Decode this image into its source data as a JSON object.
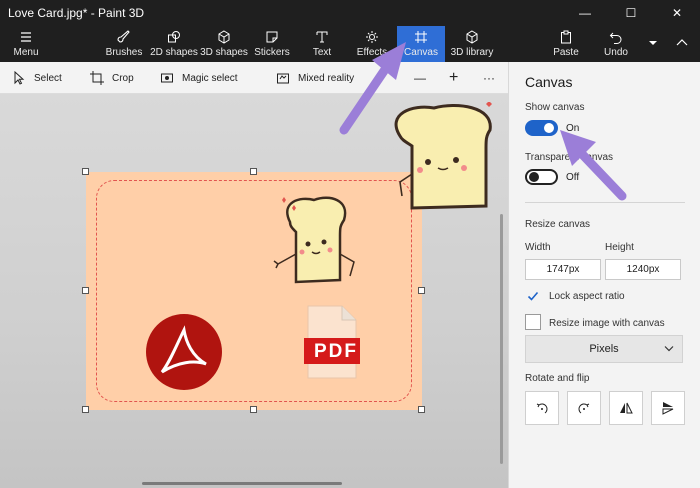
{
  "window": {
    "title": "Love Card.jpg* - Paint 3D",
    "minimize_glyph": "—",
    "maximize_glyph": "☐",
    "close_glyph": "✕"
  },
  "ribbon": {
    "menu": {
      "label": "Menu",
      "icon": "hamburger-menu-icon"
    },
    "tools": [
      {
        "label": "Brushes",
        "icon": "brush-icon"
      },
      {
        "label": "2D shapes",
        "icon": "2d-shapes-icon"
      },
      {
        "label": "3D shapes",
        "icon": "3d-shapes-icon"
      },
      {
        "label": "Stickers",
        "icon": "sticker-icon"
      },
      {
        "label": "Text",
        "icon": "text-icon"
      },
      {
        "label": "Effects",
        "icon": "effects-icon"
      },
      {
        "label": "Canvas",
        "icon": "canvas-icon",
        "active": true
      },
      {
        "label": "3D library",
        "icon": "3d-library-icon"
      }
    ],
    "paste": {
      "label": "Paste",
      "icon": "paste-icon"
    },
    "undo": {
      "label": "Undo",
      "icon": "undo-icon"
    },
    "accent_color": "#2f6ed6"
  },
  "subtoolbar": {
    "select": "Select",
    "crop": "Crop",
    "magic_select": "Magic select",
    "mixed_reality": "Mixed reality",
    "zoom_out": "—",
    "zoom_in": "+",
    "more": "···"
  },
  "canvas": {
    "background_color": "#ffcfa8",
    "border_color": "#e2554f",
    "pdf_label": "PDF"
  },
  "panel": {
    "title": "Canvas",
    "show_canvas": {
      "label": "Show canvas",
      "state": "On"
    },
    "transparent_canvas": {
      "label": "Transparent canvas",
      "state": "Off"
    },
    "resize_heading": "Resize canvas",
    "width_label": "Width",
    "height_label": "Height",
    "width_value": "1747px",
    "height_value": "1240px",
    "lock_aspect": {
      "label": "Lock aspect ratio",
      "checked": true
    },
    "resize_with_canvas": {
      "label": "Resize image with canvas",
      "checked": false
    },
    "units": "Pixels",
    "rotate_heading": "Rotate and flip",
    "toggle_on_color": "#1e63c9"
  },
  "annotation_color": "#9b7ed8"
}
